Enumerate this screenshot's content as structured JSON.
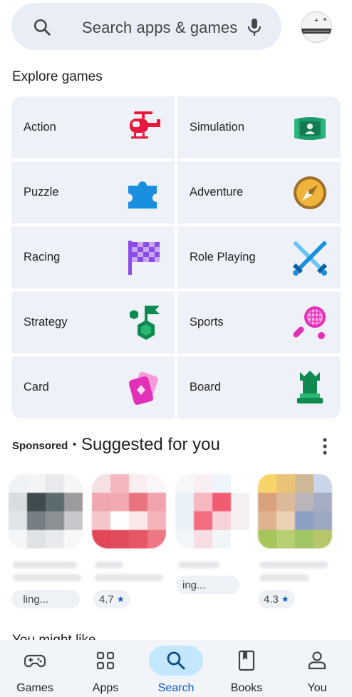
{
  "search": {
    "placeholder": "Search apps & games",
    "icon": "search-icon",
    "mic_icon": "mic-icon"
  },
  "explore": {
    "title": "Explore games",
    "categories": [
      {
        "label": "Action",
        "icon": "helicopter-icon"
      },
      {
        "label": "Simulation",
        "icon": "stadium-icon"
      },
      {
        "label": "Puzzle",
        "icon": "puzzle-piece-icon"
      },
      {
        "label": "Adventure",
        "icon": "compass-icon"
      },
      {
        "label": "Racing",
        "icon": "checkered-flag-icon"
      },
      {
        "label": "Role Playing",
        "icon": "crossed-swords-icon"
      },
      {
        "label": "Strategy",
        "icon": "strategy-flag-icon"
      },
      {
        "label": "Sports",
        "icon": "tennis-racket-icon"
      },
      {
        "label": "Card",
        "icon": "cards-icon"
      },
      {
        "label": "Board",
        "icon": "chess-rook-icon"
      }
    ]
  },
  "suggested": {
    "sponsored_label": "Sponsored",
    "separator": "•",
    "title": "Suggested for you",
    "apps": [
      {
        "pill": "  ling..."
      },
      {
        "rating": "4.7"
      },
      {
        "pill": "ing..."
      },
      {
        "rating": "4.3"
      }
    ]
  },
  "next_section": {
    "title": "You might like"
  },
  "bottom_nav": {
    "items": [
      {
        "label": "Games",
        "icon": "gamepad-icon"
      },
      {
        "label": "Apps",
        "icon": "apps-grid-icon"
      },
      {
        "label": "Search",
        "icon": "search-icon"
      },
      {
        "label": "Books",
        "icon": "book-icon"
      },
      {
        "label": "You",
        "icon": "person-icon"
      }
    ],
    "active": "Search"
  },
  "colors": {
    "accent": "#0b57d0",
    "active_pill": "#c2e7ff",
    "search_bg": "#e9eef6",
    "tile_bg": "#eef2f8"
  }
}
